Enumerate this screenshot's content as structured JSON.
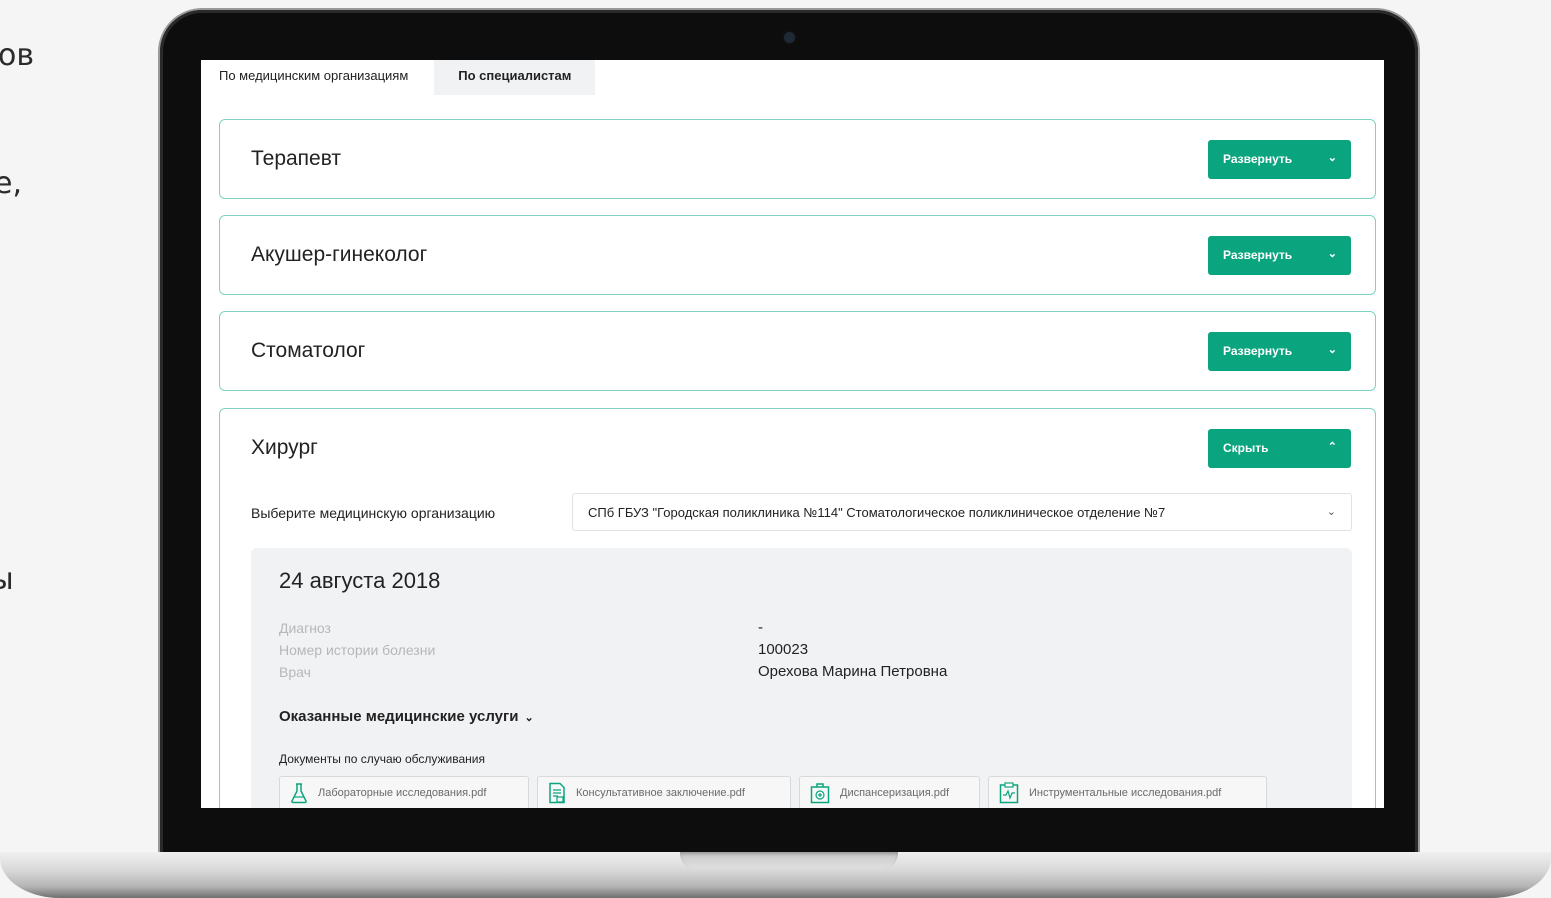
{
  "side_fragments": [
    "ов",
    "е,",
    "ы"
  ],
  "tabs": [
    {
      "label": "По медицинским организациям",
      "active": false
    },
    {
      "label": "По специалистам",
      "active": true
    }
  ],
  "specialists": [
    {
      "title": "Терапевт",
      "button": "Развернуть",
      "expanded": false
    },
    {
      "title": "Акушер-гинеколог",
      "button": "Развернуть",
      "expanded": false
    },
    {
      "title": "Стоматолог",
      "button": "Развернуть",
      "expanded": false
    },
    {
      "title": "Хирург",
      "button": "Скрыть",
      "expanded": true
    }
  ],
  "surgeon": {
    "org_label": "Выберите медицинскую организацию",
    "org_selected": "СПб ГБУЗ \"Городская поликлиника №114\" Стоматологическое поликлиническое отделение №7",
    "visit": {
      "date": "24 августа 2018",
      "fields": [
        {
          "key": "Диагноз",
          "value": "-"
        },
        {
          "key": "Номер истории болезни",
          "value": "100023"
        },
        {
          "key": "Врач",
          "value": "Орехова Марина Петровна"
        }
      ],
      "services_label": "Оказанные медицинские услуги",
      "docs_label": "Документы по случаю обслуживания",
      "documents": [
        {
          "name": "Лабораторные исследования.pdf",
          "icon": "flask-icon"
        },
        {
          "name": "Консультативное заключение.pdf",
          "icon": "document-icon"
        },
        {
          "name": "Диспансеризация.pdf",
          "icon": "medical-kit-icon"
        },
        {
          "name": "Инструментальные исследования.pdf",
          "icon": "clipboard-chart-icon"
        }
      ]
    }
  },
  "colors": {
    "accent": "#0aa57f",
    "card_border": "#7fd3c1",
    "panel_bg": "#f1f2f4"
  }
}
